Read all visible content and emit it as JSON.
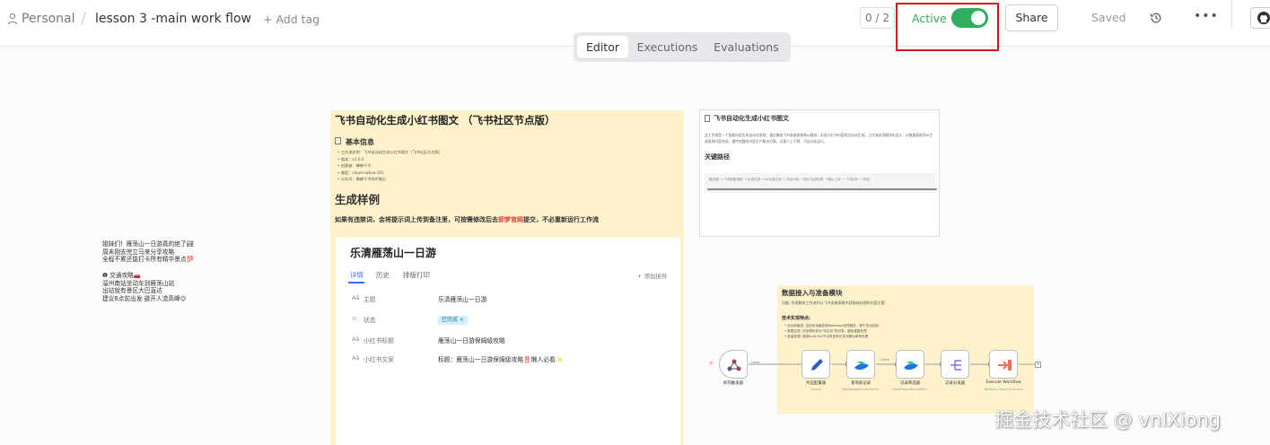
{
  "header": {
    "workspace": "Personal",
    "separator": "/",
    "workflow_name": "lesson 3 -main work flow",
    "add_tag": "+ Add tag",
    "counter": "0 / 2",
    "active_label": "Active",
    "active_on": true,
    "share_label": "Share",
    "saved_label": "Saved",
    "more_label": "•••",
    "colors": {
      "active": "#2eaf5d",
      "highlight": "#d9131b"
    }
  },
  "tabs": [
    {
      "label": "Editor",
      "selected": true
    },
    {
      "label": "Executions",
      "selected": false
    },
    {
      "label": "Evaluations",
      "selected": false
    }
  ],
  "sticky_main": {
    "title": "飞书自动化生成小红书图文 （飞书社区节点版）",
    "info_title": "基本信息",
    "info_items": [
      "工作流名称：飞书自动化生成小红书图文（飞书社区节点版）",
      "版本：v1.0.0",
      "创建者：拂晓千子",
      "难度：cloud-native-101",
      "公众号：拂晓千子的AI笔记"
    ],
    "example_heading": "生成样例",
    "notice_before": "如果有违禁词，会将提示词上传到备注里，可按需修改后去",
    "notice_link": "即梦官网",
    "notice_after": "提交，不必重新运行工作流",
    "record": {
      "title": "乐清雁荡山一日游",
      "tabs": [
        "详情",
        "历史",
        "排版打印"
      ],
      "add_plugin": "+ 添加插件",
      "fields": [
        {
          "label": "主题",
          "value": "乐清雁荡山一日游"
        },
        {
          "label": "状态",
          "value": "已完成 ×"
        },
        {
          "label": "小红书标题",
          "value": "雁荡山一日游保姆级攻略"
        },
        {
          "label": "小红书文案",
          "value": "标题：雁荡山一日游保姆级攻略‼️懒人必看✨"
        }
      ],
      "body": "姐妹们！雁荡山一日游真的绝了🏞\n周末刚去完立马来分享攻略\n全程不累还能打卡所有精华景点💯\n\n❶ 交通攻略🚗\n温州南站坐动车到雁荡山站\n出站就有景区大巴直达\n建议8点前出发 避开人流高峰😉"
    }
  },
  "sticky_info": {
    "title": "飞书自动化生成小红书图文",
    "description": "这工作流是一个智能内容生成自动化系统，通过集成飞书多维表格和AI服务，实现小红书内容的全自动生成。工作流采用模块化设计，从数据获取到AI生成再到内容合成，提供完整的内容生产解决方案，无需人工干预，可自动化运行。",
    "path_title": "关键路径",
    "path_text": "触发器 → 飞书数据读取 → 记录过滤 → AI文案生成 → 内容分段 → 图片生成处理 → 图片上传 → 飞书回写 → 完成"
  },
  "sticky_module": {
    "title": "数据接入与准备模块",
    "function": "功能: 负责触发工作流并从飞书多维表格中获取待处理的内容主题",
    "tech_title": "技术实现特点:",
    "tech_items": [
      "自动化触发: 支持手动触发和Webhook定时触发，便于灵活控制",
      "数据过滤: 仅处理状态为\"待生成\"的记录，避免重复处理",
      "批量处理: 使用Split Out节点将多条记录分解为单条处理"
    ]
  },
  "workflow": {
    "items_label": "1 item",
    "items_label_2": "1 item",
    "nodes": [
      {
        "id": "trigger",
        "label": "如何触发器",
        "sub": ""
      },
      {
        "id": "config",
        "label": "凭证配置器",
        "sub": "manual"
      },
      {
        "id": "feishu-read",
        "label": "查询表记录",
        "sub": "bitableAppsRecordSearch"
      },
      {
        "id": "feishu-filter",
        "label": "记录筛选器",
        "sub": "bitableAppsRecordFilter"
      },
      {
        "id": "split",
        "label": "记录分发器",
        "sub": ""
      },
      {
        "id": "execute",
        "label": "Execute Workflow",
        "sub": "Workflow: lesson3-sub-flow"
      }
    ],
    "colors": {
      "trigger": "#ff6d5a",
      "config": "#2c5cc5",
      "feishu": "#2171e5",
      "split": "#7b61ff",
      "execute": "#ff6d5a"
    }
  },
  "watermark": "掘金技术社区 @ vnIXiong"
}
